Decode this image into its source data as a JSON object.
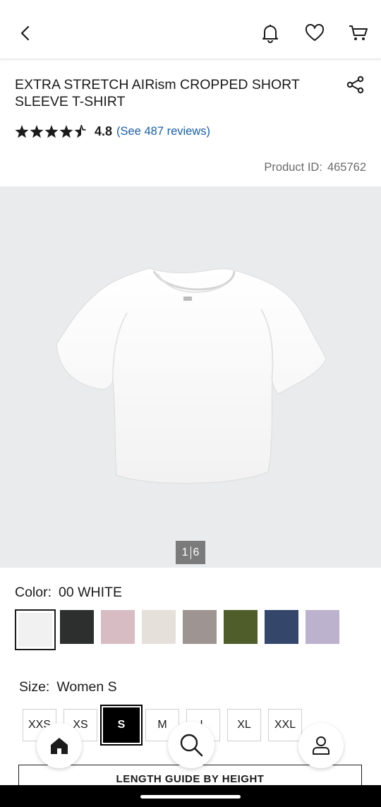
{
  "header": {
    "back_icon": "chevron-left-icon",
    "actions": [
      "bell-icon",
      "heart-icon",
      "cart-icon"
    ]
  },
  "product": {
    "title": "EXTRA STRETCH AIRism CROPPED SHORT SLEEVE T-SHIRT",
    "rating_stars": 4.5,
    "rating_value": "4.8",
    "reviews_link": "(See 487 reviews)",
    "product_id_label": "Product ID:",
    "product_id_value": "465762"
  },
  "gallery": {
    "current": "1",
    "total": "6"
  },
  "color": {
    "label": "Color:",
    "selected": "00 WHITE",
    "swatches": [
      "#f1f1f1",
      "#2d2f2f",
      "#d7bcc4",
      "#e6e0da",
      "#9e9592",
      "#4f5d2b",
      "#34466a",
      "#bdb2cd"
    ]
  },
  "size": {
    "label": "Size:",
    "selected": "Women S",
    "options": [
      "XXS",
      "XS",
      "S",
      "M",
      "L",
      "XL",
      "XXL"
    ]
  },
  "length_guide": "LENGTH GUIDE BY HEIGHT",
  "bottom_nav": [
    "home-icon",
    "search-icon",
    "user-icon"
  ]
}
